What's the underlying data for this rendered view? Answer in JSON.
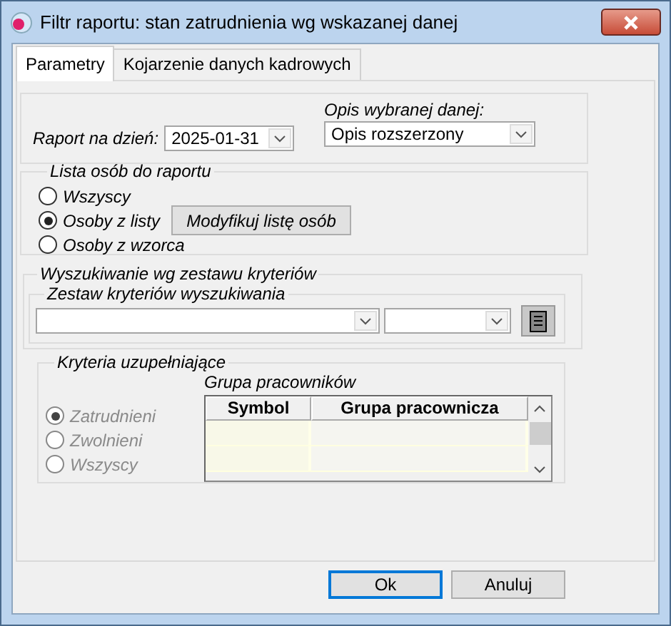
{
  "window": {
    "title": "Filtr raportu: stan zatrudnienia wg wskazanej danej"
  },
  "tabs": [
    {
      "label": "Parametry",
      "selected": true
    },
    {
      "label": "Kojarzenie danych kadrowych",
      "selected": false
    }
  ],
  "report_date": {
    "label": "Raport na dzień:",
    "value": "2025-01-31"
  },
  "description": {
    "label": "Opis wybranej danej:",
    "value": "Opis rozszerzony"
  },
  "person_list": {
    "title": "Lista osób do raportu",
    "modify_button": "Modyfikuj listę osób",
    "options": [
      {
        "label": "Wszyscy",
        "selected": false
      },
      {
        "label": "Osoby z listy",
        "selected": true
      },
      {
        "label": "Osoby z wzorca",
        "selected": false
      }
    ]
  },
  "search": {
    "title": "Wyszukiwanie wg zestawu kryteriów",
    "set_title": "Zestaw kryteriów wyszukiwania"
  },
  "extra": {
    "title": "Kryteria uzupełniające",
    "group_title": "Grupa pracowników",
    "columns": [
      "Symbol",
      "Grupa pracownicza"
    ],
    "options": [
      {
        "label": "Zatrudnieni",
        "selected": true,
        "disabled": true
      },
      {
        "label": "Zwolnieni",
        "selected": false,
        "disabled": true
      },
      {
        "label": "Wszyscy",
        "selected": false,
        "disabled": true
      }
    ]
  },
  "buttons": [
    {
      "label": "Ok",
      "default": true
    },
    {
      "label": "Anuluj",
      "default": false
    }
  ]
}
